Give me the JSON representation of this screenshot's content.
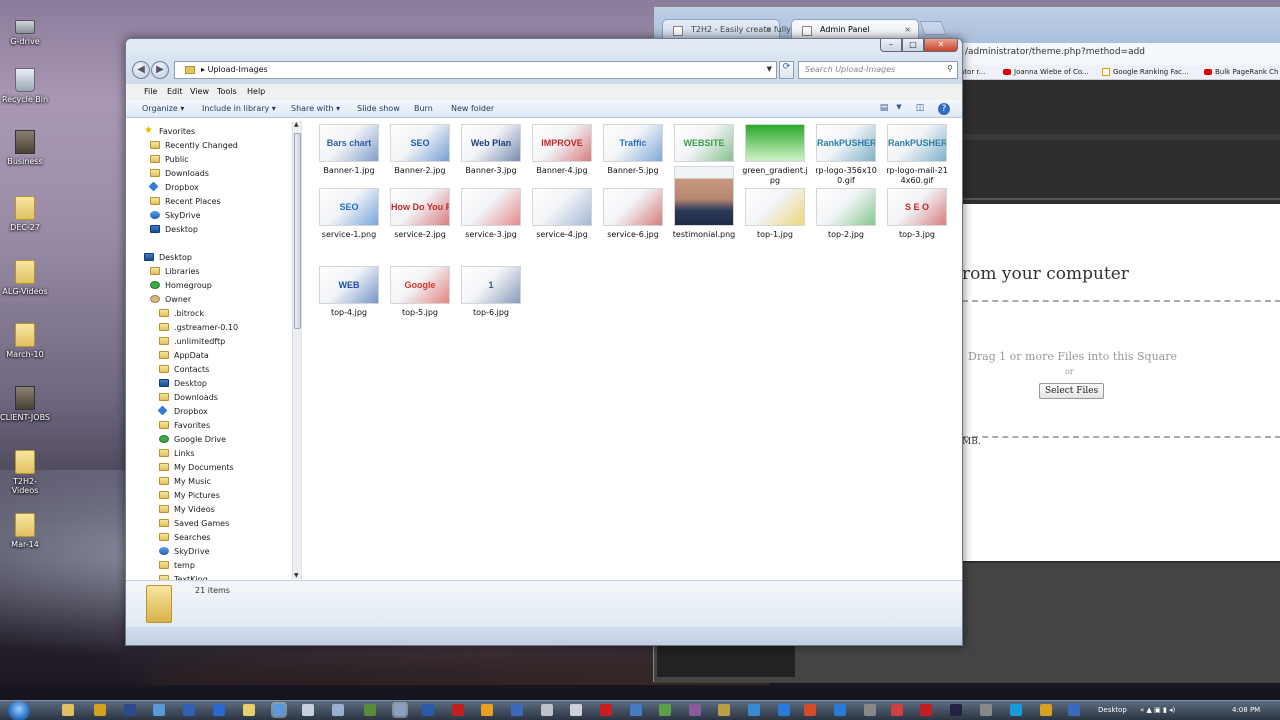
{
  "desktop": {
    "icons": [
      {
        "label": "G-drive",
        "kind": "drive"
      },
      {
        "label": "Recycle Bin",
        "kind": "bin"
      },
      {
        "label": "Business",
        "kind": "dark"
      },
      {
        "label": "DEC-27",
        "kind": "folder"
      },
      {
        "label": "ALG-Videos",
        "kind": "folder"
      },
      {
        "label": "March-10",
        "kind": "folder"
      },
      {
        "label": "CLIENT-JOBS",
        "kind": "dark"
      },
      {
        "label": "T2H2-Videos",
        "kind": "folder"
      },
      {
        "label": "Mar-14",
        "kind": "folder"
      }
    ]
  },
  "browser": {
    "tabs": [
      {
        "label": "T2H2 - Easily create fully",
        "active": false
      },
      {
        "label": "Admin Panel",
        "active": true
      }
    ],
    "url_fragment": "/administrator/theme.php?method=add",
    "bookmarks": [
      "ator r...",
      "Joanna Wiebe of Co...",
      "Google Ranking Fac...",
      "Bulk PageRank Ch"
    ],
    "page": {
      "heading": "rom your computer",
      "drag_text": "Drag 1 or more Files into this Square",
      "or_text": "or",
      "select_button": "Select Files",
      "size_note": "MB."
    }
  },
  "explorer": {
    "breadcrumb": "Upload-Images",
    "search_placeholder": "Search Upload-Images",
    "menu": [
      "File",
      "Edit",
      "View",
      "Tools",
      "Help"
    ],
    "toolbar": [
      "Organize",
      "Include in library",
      "Share with",
      "Slide show",
      "Burn",
      "New folder"
    ],
    "nav": [
      {
        "label": "Favorites",
        "icon": "star-icon",
        "level": 0
      },
      {
        "label": "Recently Changed",
        "icon": "folder-icon",
        "level": 1
      },
      {
        "label": "Public",
        "icon": "folder-icon",
        "level": 1
      },
      {
        "label": "Downloads",
        "icon": "folder-icon",
        "level": 1
      },
      {
        "label": "Dropbox",
        "icon": "dropbox-icon",
        "level": 1
      },
      {
        "label": "Recent Places",
        "icon": "folder-icon",
        "level": 1
      },
      {
        "label": "SkyDrive",
        "icon": "skydrive-icon",
        "level": 1
      },
      {
        "label": "Desktop",
        "icon": "desktop-icon",
        "level": 1
      },
      {
        "label": "Desktop",
        "icon": "desktop-icon",
        "level": 0
      },
      {
        "label": "Libraries",
        "icon": "folder-icon",
        "level": 1
      },
      {
        "label": "Homegroup",
        "icon": "homegroup-icon",
        "level": 1
      },
      {
        "label": "Owner",
        "icon": "user-icon",
        "level": 1
      },
      {
        "label": ".bitrock",
        "icon": "folder-icon",
        "level": 2
      },
      {
        "label": ".gstreamer-0.10",
        "icon": "folder-icon",
        "level": 2
      },
      {
        "label": ".unlimitedftp",
        "icon": "folder-icon",
        "level": 2
      },
      {
        "label": "AppData",
        "icon": "folder-icon",
        "level": 2
      },
      {
        "label": "Contacts",
        "icon": "folder-icon",
        "level": 2
      },
      {
        "label": "Desktop",
        "icon": "desktop-icon",
        "level": 2
      },
      {
        "label": "Downloads",
        "icon": "folder-icon",
        "level": 2
      },
      {
        "label": "Dropbox",
        "icon": "dropbox-icon",
        "level": 2
      },
      {
        "label": "Favorites",
        "icon": "folder-icon",
        "level": 2
      },
      {
        "label": "Google Drive",
        "icon": "gdrive-icon",
        "level": 2
      },
      {
        "label": "Links",
        "icon": "folder-icon",
        "level": 2
      },
      {
        "label": "My Documents",
        "icon": "folder-icon",
        "level": 2
      },
      {
        "label": "My Music",
        "icon": "folder-icon",
        "level": 2
      },
      {
        "label": "My Pictures",
        "icon": "folder-icon",
        "level": 2
      },
      {
        "label": "My Videos",
        "icon": "folder-icon",
        "level": 2
      },
      {
        "label": "Saved Games",
        "icon": "folder-icon",
        "level": 2
      },
      {
        "label": "Searches",
        "icon": "folder-icon",
        "level": 2
      },
      {
        "label": "SkyDrive",
        "icon": "skydrive-icon",
        "level": 2
      },
      {
        "label": "temp",
        "icon": "folder-icon",
        "level": 2
      },
      {
        "label": "TextKing",
        "icon": "folder-icon",
        "level": 2
      }
    ],
    "files": [
      {
        "name": "Banner-1.jpg",
        "art": "Bars chart",
        "color": "#2f5fa5"
      },
      {
        "name": "Banner-2.jpg",
        "art": "SEO",
        "color": "#1d5fb8"
      },
      {
        "name": "Banner-3.jpg",
        "art": "Web Plan",
        "color": "#1f3f7c"
      },
      {
        "name": "Banner-4.jpg",
        "art": "IMPROVE",
        "color": "#c0282a"
      },
      {
        "name": "Banner-5.jpg",
        "art": "Traffic",
        "color": "#2a6fc0"
      },
      {
        "name": "Banner-6.jpg",
        "art": "WEBSITE",
        "color": "#3a9a48"
      },
      {
        "name": "green_gradient.jpg",
        "art": "",
        "color": "#4ec04a"
      },
      {
        "name": "rp-logo-356x100.gif",
        "art": "RankPUSHER",
        "color": "#2b7fa6"
      },
      {
        "name": "rp-logo-mail-214x60.gif",
        "art": "RankPUSHER",
        "color": "#2b7fa6"
      },
      {
        "name": "service-1.png",
        "art": "SEO",
        "color": "#1d6cc8"
      },
      {
        "name": "service-2.jpg",
        "art": "How Do You Rank?",
        "color": "#c4282a"
      },
      {
        "name": "service-3.jpg",
        "art": "",
        "color": "#d84040"
      },
      {
        "name": "service-4.jpg",
        "art": "",
        "color": "#6a8abf"
      },
      {
        "name": "service-6.jpg",
        "art": "",
        "color": "#c02828"
      },
      {
        "name": "testimonial.png",
        "art": "",
        "color": "#8a6a5a"
      },
      {
        "name": "top-1.jpg",
        "art": "",
        "color": "#e8c020"
      },
      {
        "name": "top-2.jpg",
        "art": "",
        "color": "#3aa848"
      },
      {
        "name": "top-3.jpg",
        "art": "S E O",
        "color": "#c02828"
      },
      {
        "name": "top-4.jpg",
        "art": "WEB",
        "color": "#1d4fa8"
      },
      {
        "name": "top-5.jpg",
        "art": "Google",
        "color": "#d8342c"
      },
      {
        "name": "top-6.jpg",
        "art": "1",
        "color": "#3a5a8c"
      }
    ],
    "item_count": "21 items"
  },
  "taskbar": {
    "desktop_label": "Desktop",
    "time": "4:08 PM"
  }
}
